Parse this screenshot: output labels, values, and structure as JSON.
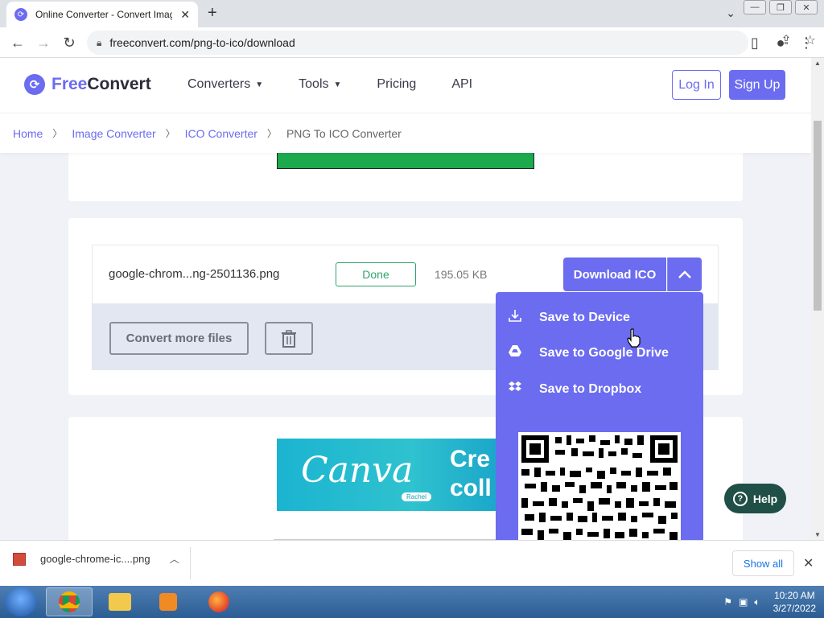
{
  "browser": {
    "tab_title": "Online Converter - Convert Imag",
    "url": "freeconvert.com/png-to-ico/download"
  },
  "site": {
    "logo_part1": "Free",
    "logo_part2": "Convert",
    "nav": [
      {
        "label": "Converters"
      },
      {
        "label": "Tools"
      },
      {
        "label": "Pricing"
      },
      {
        "label": "API"
      }
    ],
    "login_label": "Log In",
    "signup_label": "Sign Up",
    "brand_color": "#6b6cf0"
  },
  "breadcrumb": [
    "Home",
    "Image Converter",
    "ICO Converter",
    "PNG To ICO Converter"
  ],
  "file": {
    "name": "google-chrom...ng-2501136.png",
    "status": "Done",
    "size": "195.05 KB",
    "download_label": "Download ICO",
    "convert_more_label": "Convert more files"
  },
  "dropdown": {
    "items": [
      {
        "label": "Save to Device",
        "icon": "download-icon"
      },
      {
        "label": "Save to Google Drive",
        "icon": "google-drive-icon"
      },
      {
        "label": "Save to Dropbox",
        "icon": "dropbox-icon"
      }
    ]
  },
  "ad": {
    "canva_logo": "Canva",
    "canva_badge": "Rachel",
    "canva_text_line1": "Cre",
    "canva_text_line2": "coll"
  },
  "help_label": "Help",
  "shelf": {
    "filename": "google-chrome-ic....png",
    "show_all": "Show all"
  },
  "taskbar": {
    "time": "10:20 AM",
    "date": "3/27/2022"
  }
}
